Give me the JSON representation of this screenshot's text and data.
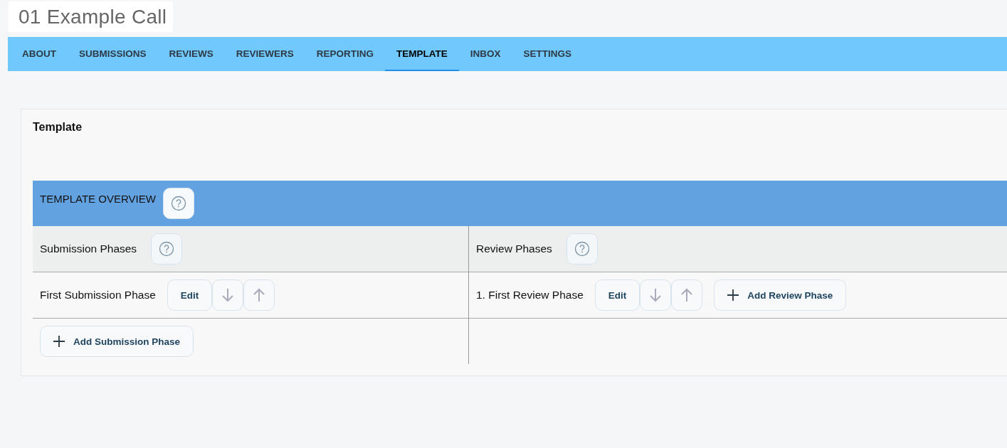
{
  "app_title": "01 Example Call",
  "tabs": [
    {
      "label": "ABOUT",
      "selected": false
    },
    {
      "label": "SUBMISSIONS",
      "selected": false
    },
    {
      "label": "REVIEWS",
      "selected": false
    },
    {
      "label": "REVIEWERS",
      "selected": false
    },
    {
      "label": "REPORTING",
      "selected": false
    },
    {
      "label": "TEMPLATE",
      "selected": true
    },
    {
      "label": "INBOX",
      "selected": false
    },
    {
      "label": "SETTINGS",
      "selected": false
    }
  ],
  "section_title": "Template",
  "overview": {
    "title": "TEMPLATE OVERVIEW"
  },
  "columns": [
    {
      "heading": "Submission Phases",
      "phases": [
        {
          "name": "First Submission Phase",
          "edit_label": "Edit"
        }
      ],
      "add_label": "Add Submission Phase",
      "kind": "below"
    },
    {
      "heading": "Review Phases",
      "phases": [
        {
          "name": "1. First Review Phase",
          "edit_label": "Edit"
        }
      ],
      "add_label": "Add Review Phase",
      "kind": "inline"
    }
  ]
}
